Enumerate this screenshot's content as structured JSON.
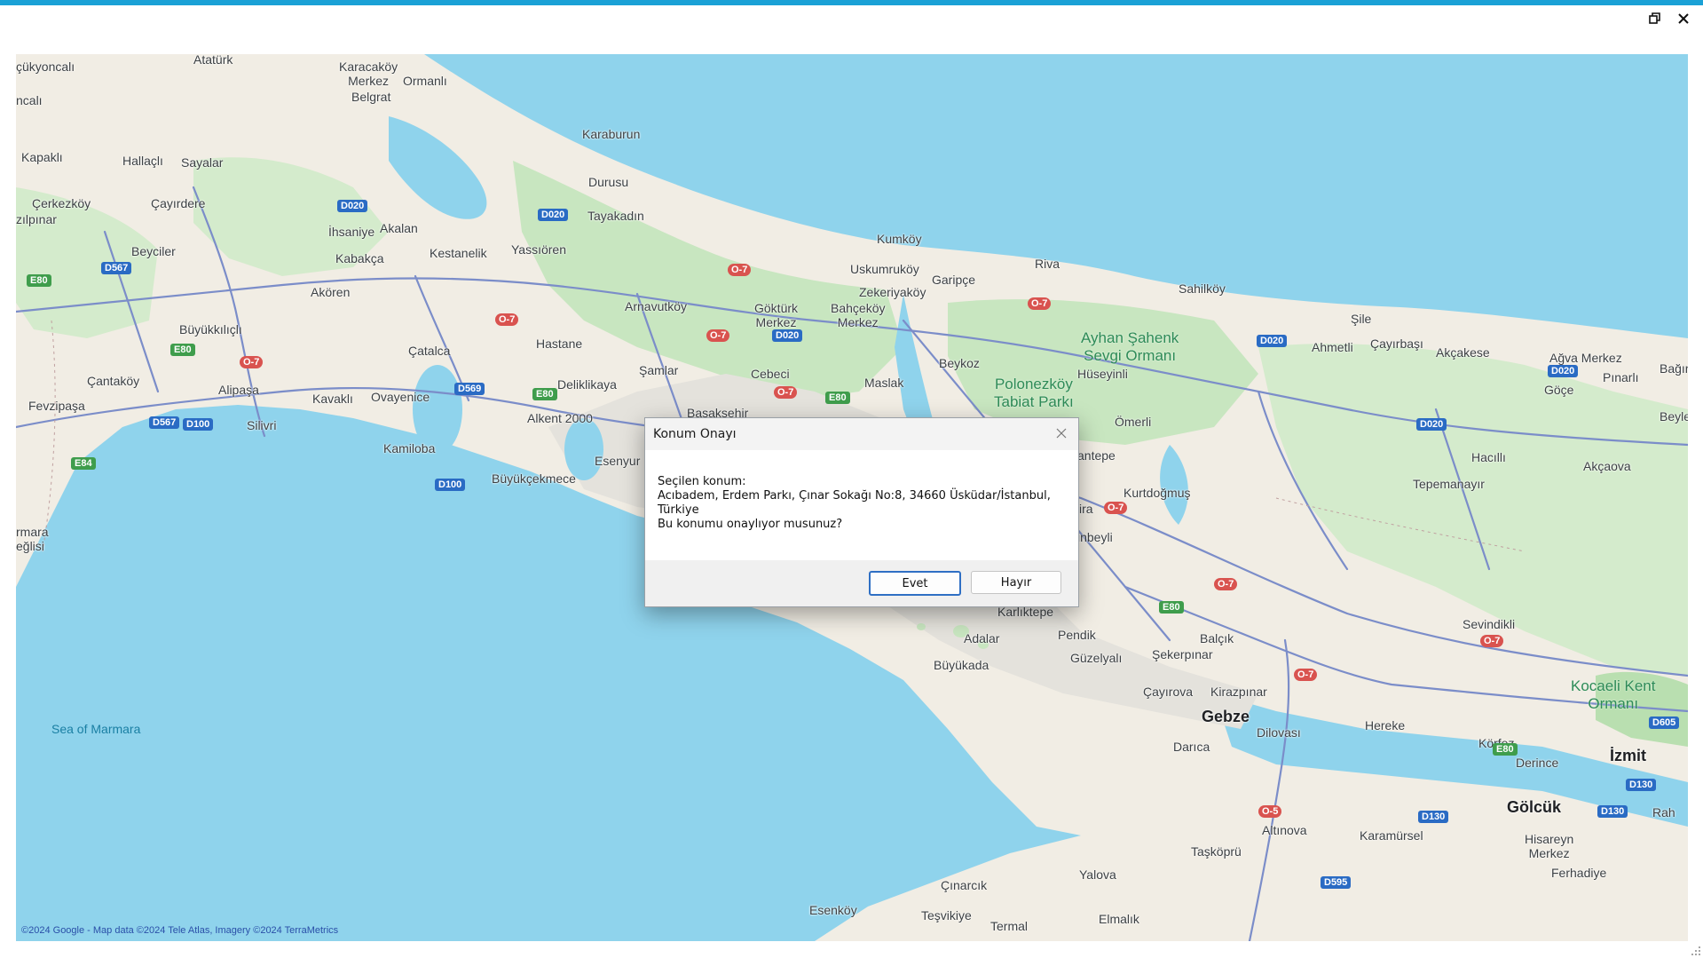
{
  "window": {
    "restore_icon": "restore-icon",
    "close_icon": "close-icon",
    "accent": "#1aa1d6"
  },
  "map": {
    "copyright": "©2024 Google - Map data ©2024 Tele Atlas, Imagery ©2024 TerraMetrics",
    "labels": {
      "ataturk": "Atatürk",
      "karacakoy_merkez": "Karacaköy\nMerkez",
      "belgrat": "Belgrat",
      "ormanli": "Ormanlı",
      "cukyoncali": "çükyoncalı",
      "ncali": "ncalı",
      "kapakli": "Kapaklı",
      "hallacli": "Hallaçlı",
      "sayalar": "Sayalar",
      "cerkezkoy": "Çerkezköy",
      "zilpinar": "zılpınar",
      "cayirdere": "Çayırdere",
      "ihsaniye": "İhsaniye",
      "akalan": "Akalan",
      "beyciler": "Beyciler",
      "kabakca": "Kabakça",
      "kestanelik": "Kestanelik",
      "yassioren": "Yassıören",
      "karaburun": "Karaburun",
      "durusu": "Durusu",
      "tayakadin": "Tayakadın",
      "akoren": "Akören",
      "buyukkilicli": "Büyükkılıçlı",
      "catalca": "Çatalca",
      "cantakoy": "Çantaköy",
      "alipasa": "Alipaşa",
      "fevzipasa": "Fevzipaşa",
      "kavakli": "Kavaklı",
      "ovayenice": "Ovayenice",
      "silivri": "Silivri",
      "kamiloba": "Kamiloba",
      "buyukcekmece": "Büyükçekmece",
      "hastane": "Hastane",
      "deliklikaya": "Deliklikaya",
      "alkent": "Alkent 2000",
      "esenyurt": "Esenyur",
      "arnavutkoy": "Arnavutköy",
      "samlar": "Şamlar",
      "gokturk_merkez": "Göktürk\nMerkez",
      "bahcekoy_merkez": "Bahçeköy\nMerkez",
      "cebeci": "Cebeci",
      "maslak": "Maslak",
      "kumkoy": "Kumköy",
      "uskumrukoy": "Uskumruköy",
      "zekeriyakoy": "Zekeriyaköy",
      "garipce": "Garipçe",
      "riva": "Riva",
      "beykoz": "Beykoz",
      "polonezkoy": "Polonezköy\nTabiat Parkı",
      "ayhan_sahenk": "Ayhan Şahenk\nSevgi Ormanı",
      "huseyinli": "Hüseyinli",
      "omerli": "Ömerli",
      "sahilkoy": "Sahilköy",
      "sile": "Şile",
      "ahmetli": "Ahmetli",
      "cayirbasi": "Çayırbaşı",
      "akcakese": "Akçakese",
      "agva_merkez": "Ağva Merkez",
      "goce": "Göçe",
      "pinarli": "Pınarlı",
      "bagirganli": "Bağır",
      "beylerbeyi": "Beylerb",
      "hacilli": "Hacıllı",
      "akcaova": "Akçaova",
      "tepemanayir": "Tepemanayır",
      "kurtdogmus": "Kurtdoğmuş",
      "sancaktepe": "antepe",
      "ira": "ira",
      "inbeyli": "inbeyli",
      "kartal": "Karlıktepe",
      "pendik": "Pendik",
      "adalar": "Adalar",
      "buyukada": "Büyükada",
      "guzelyali": "Güzelyalı",
      "sekerpinar": "Şekerpınar",
      "balcik": "Balçık",
      "cayirova": "Çayırova",
      "kirazpinar": "Kirazpınar",
      "gebze": "Gebze",
      "darica": "Darıca",
      "dilovasi": "Dilovası",
      "hereke": "Hereke",
      "sevindikli": "Sevindikli",
      "kocaeli_kent": "Kocaeli Kent\nOrmanı",
      "korfez": "Körfez",
      "izmit": "İzmit",
      "derince": "Derince",
      "golcuk": "Gölcük",
      "hisareyn_merkez": "Hisareyn\nMerkez",
      "ferhadiye": "Ferhadiye",
      "karamursel": "Karamürsel",
      "altinova": "Altınova",
      "taskopru": "Taşköprü",
      "yalova": "Yalova",
      "cinarcik": "Çınarcık",
      "esenkoy": "Esenköy",
      "tesvikiye": "Teşvikiye",
      "termal": "Termal",
      "elmalik": "Elmalık",
      "sea_of_marmara": "Sea of Marmara",
      "marmara_eglisi": "rmara\neğlisi",
      "rah": "Rah",
      "basaksehir": "Başakşehir"
    },
    "shields": {
      "d020": "D020",
      "d567": "D567",
      "e80": "E80",
      "o7": "O-7",
      "d100": "D100",
      "e84": "E84",
      "d569": "D569",
      "d130": "D130",
      "o5": "O-5",
      "d595": "D595",
      "d605": "D605"
    },
    "colors": {
      "water": "#8fd3ec",
      "land": "#f1ede4",
      "forest": "#c8e6c0",
      "urban": "#e6e3dc",
      "road": "#7b8dc9"
    }
  },
  "dialog": {
    "title": "Konum Onayı",
    "close_icon": "close-icon",
    "line1": "Seçilen konum:",
    "line2": "Acıbadem, Erdem Parkı, Çınar Sokağı No:8, 34660 Üsküdar/İstanbul,\nTürkiye",
    "line3": "Bu konumu onaylıyor musunuz?",
    "yes_label": "Evet",
    "no_label": "Hayır"
  }
}
